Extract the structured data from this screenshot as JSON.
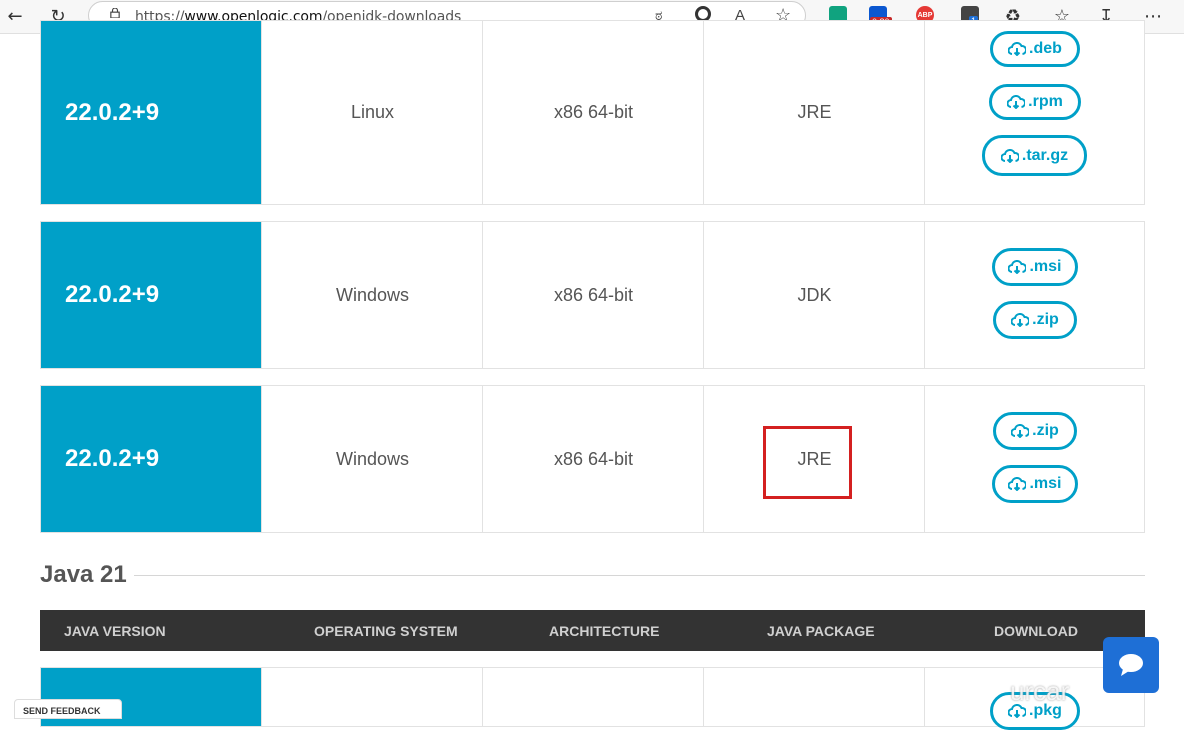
{
  "browser": {
    "url_prefix": "https://",
    "url_domain": "www.openlogic.com",
    "url_path": "/openjdk-downloads",
    "extensions": [
      {
        "name": "chatgpt-extension-icon",
        "color": "#10a37f"
      },
      {
        "name": "media-extension-icon",
        "color": "#0b57d0",
        "badge": "0.80"
      },
      {
        "name": "adblock-plus-icon",
        "color": "#e53935",
        "label": "ABP"
      },
      {
        "name": "translate-extension-icon",
        "color": "#444444",
        "badge": "1"
      }
    ]
  },
  "rows": [
    {
      "version": "22.0.2+9",
      "os": "Linux",
      "arch": "x86 64-bit",
      "package": "JRE",
      "downloads": [
        ".deb",
        ".rpm",
        ".tar.gz"
      ]
    },
    {
      "version": "22.0.2+9",
      "os": "Windows",
      "arch": "x86 64-bit",
      "package": "JDK",
      "downloads": [
        ".msi",
        ".zip"
      ]
    },
    {
      "version": "22.0.2+9",
      "os": "Windows",
      "arch": "x86 64-bit",
      "package": "JRE",
      "downloads": [
        ".zip",
        ".msi"
      ]
    }
  ],
  "java21": {
    "title": "Java 21",
    "headers": [
      "JAVA VERSION",
      "OPERATING SYSTEM",
      "ARCHITECTURE",
      "JAVA PACKAGE",
      "DOWNLOAD"
    ],
    "partial_download": ".pkg"
  },
  "feedback_label": "SEND FEEDBACK",
  "watermark": "urcar",
  "colors": {
    "accent": "#00a0c8",
    "highlight": "#d42020",
    "header_bg": "#333333",
    "chat": "#1e6fd6"
  }
}
